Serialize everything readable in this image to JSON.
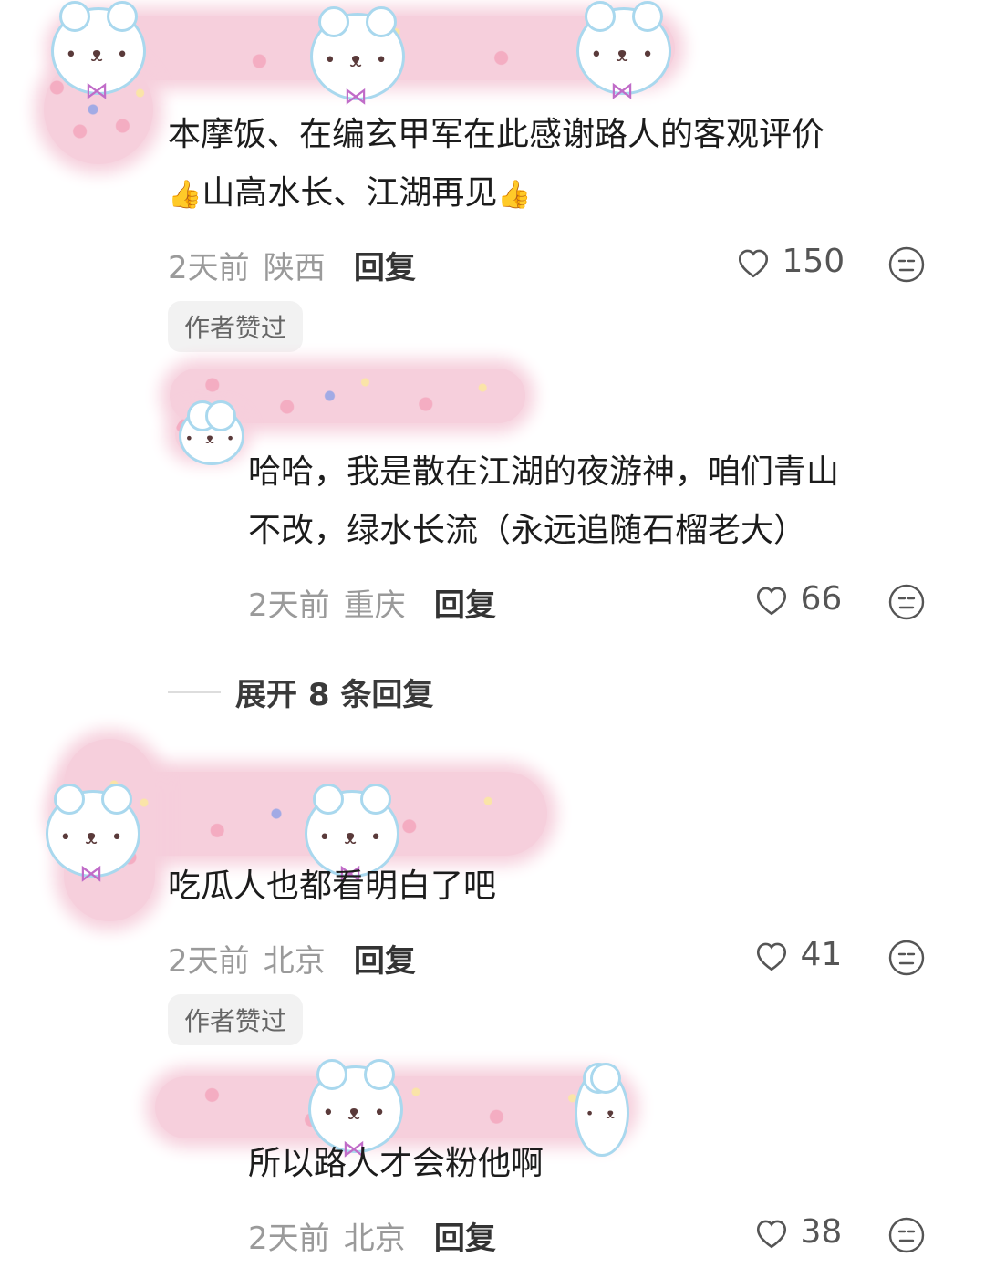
{
  "comments": [
    {
      "text_line1": "本摩饭、在编玄甲军在此感谢路人的客观评价",
      "text_line2_prefix_emoji": "👍",
      "text_line2": "山高水长、江湖再见",
      "text_line2_suffix_emoji": "👍",
      "time": "2天前",
      "location": "陕西",
      "reply_label": "回复",
      "likes": "150",
      "badge": "作者赞过",
      "replies": [
        {
          "text_line1": "哈哈，我是散在江湖的夜游神，咱们青山",
          "text_line2": "不改，绿水长流（永远追随石榴老大）",
          "time": "2天前",
          "location": "重庆",
          "reply_label": "回复",
          "likes": "66"
        }
      ],
      "expand_label": "展开 8 条回复"
    },
    {
      "text_line1": "吃瓜人也都看明白了吧",
      "time": "2天前",
      "location": "北京",
      "reply_label": "回复",
      "likes": "41",
      "badge": "作者赞过",
      "replies": [
        {
          "text_line1": "所以路人才会粉他啊",
          "time": "2天前",
          "location": "北京",
          "reply_label": "回复",
          "likes": "38"
        }
      ]
    }
  ],
  "icons": {
    "heart": "heart-outline-icon",
    "dislike": "neutral-face-icon",
    "sticker": "bear-sticker-icon"
  },
  "colors": {
    "sticker_pink": "#f6cfdc",
    "meta_gray": "#9a9a9a",
    "badge_bg": "#f2f2f2"
  }
}
